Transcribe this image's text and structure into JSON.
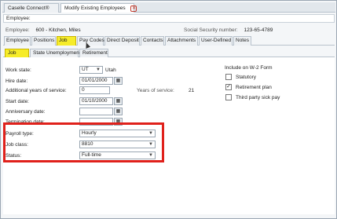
{
  "doc_tabs": [
    {
      "label": "Caselle Connect®"
    },
    {
      "label": "Modify Existing Employees"
    }
  ],
  "lookup": {
    "label": "Employee:"
  },
  "info": {
    "employee_label": "Employee:",
    "employee_value": "600 - Kitchen, Miles",
    "ssn_label": "Social Security number:",
    "ssn_value": "123-65-4789"
  },
  "main_tabs": [
    "Employee",
    "Positions",
    "Job",
    "Pay Codes",
    "Direct Deposit",
    "Contacts",
    "Attachments",
    "User-Defined",
    "Notes"
  ],
  "sub_tabs": [
    "Job",
    "State Unemployment",
    "Retirement"
  ],
  "form": {
    "work_state_label": "Work state:",
    "work_state_value": "UT",
    "work_state_name": "Utah",
    "hire_date_label": "Hire date:",
    "hire_date_value": "01/01/2000",
    "add_years_label": "Additional years of service:",
    "add_years_value": "0",
    "years_label": "Years of service:",
    "years_value": "21",
    "start_date_label": "Start date:",
    "start_date_value": "01/10/2000",
    "anniversary_label": "Anniversary date:",
    "anniversary_value": "",
    "termination_label": "Termination date:",
    "termination_value": "",
    "payroll_type_label": "Payroll type:",
    "payroll_type_value": "Hourly",
    "job_class_label": "Job class:",
    "job_class_value": "8810",
    "status_label": "Status:",
    "status_value": "Full-time"
  },
  "w2": {
    "title": "Include on W-2 Form",
    "items": [
      {
        "label": "Statutory",
        "checked": "false"
      },
      {
        "label": "Retirement plan",
        "checked": "true"
      },
      {
        "label": "Third party sick pay",
        "checked": "false"
      }
    ]
  },
  "icons": {
    "close": "close-icon",
    "calendar": "calendar-icon",
    "dropdown": "chevron-down-icon",
    "check": "checkmark-icon"
  },
  "colors": {
    "highlight": "#f6ec29",
    "annotation": "#e0211b"
  }
}
